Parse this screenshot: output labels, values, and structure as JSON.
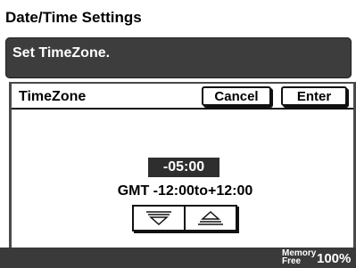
{
  "window": {
    "title": "Date/Time Settings"
  },
  "message": {
    "text": "Set TimeZone."
  },
  "panel": {
    "title": "TimeZone",
    "cancel_label": "Cancel",
    "enter_label": "Enter",
    "value": "-05:00",
    "range": "GMT -12:00to+12:00",
    "controls": {
      "decrease_icon": "triangle-down-icon",
      "increase_icon": "triangle-up-icon"
    }
  },
  "status": {
    "memory_label_1": "Memory",
    "memory_label_2": "Free",
    "memory_value": "100%"
  },
  "colors": {
    "message_bg": "#3d3d3d",
    "status_bg": "#3a3a3a",
    "value_bg": "#2e2e2e"
  }
}
